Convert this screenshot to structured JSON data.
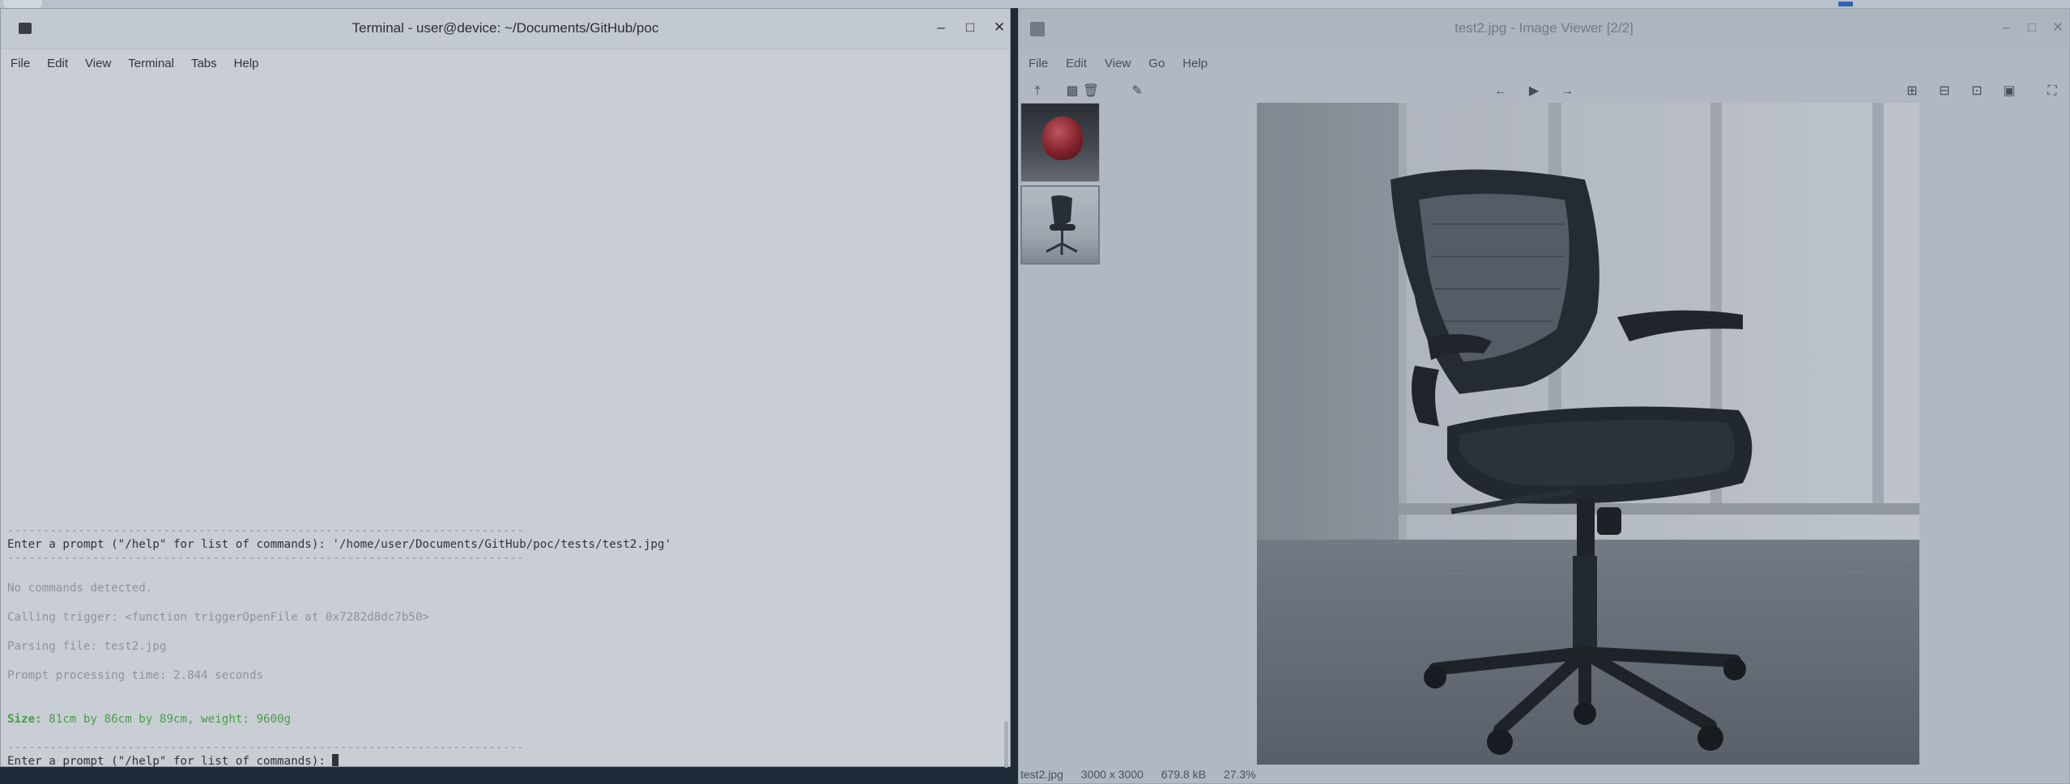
{
  "terminal": {
    "title": "Terminal - user@device: ~/Documents/GitHub/poc",
    "menu": [
      "File",
      "Edit",
      "View",
      "Terminal",
      "Tabs",
      "Help"
    ],
    "lines": {
      "sep1": "-------------------------------------------------------------------------",
      "prompt1": "Enter a prompt (\"/help\" for list of commands): '/home/user/Documents/GitHub/poc/tests/test2.jpg'",
      "sep2": "-------------------------------------------------------------------------",
      "no_commands": "No commands detected.",
      "calling": "Calling trigger: <function triggerOpenFile at 0x7282d8dc7b50>",
      "parsing": "Parsing file: test2.jpg",
      "timing": "Prompt processing time: 2.844 seconds",
      "size_label": "Size:",
      "size_value": " 81cm by 86cm by 89cm, weight: 9600g",
      "sep3": "-------------------------------------------------------------------------",
      "prompt2": "Enter a prompt (\"/help\" for list of commands): "
    }
  },
  "viewer": {
    "title": "test2.jpg - Image Viewer [2/2]",
    "menu": [
      "File",
      "Edit",
      "View",
      "Go",
      "Help"
    ],
    "status": {
      "filename": "test2.jpg",
      "dimensions": "3000 x 3000",
      "filesize": "679.8 kB",
      "zoom": "27.3%"
    }
  },
  "icons": {
    "min": "minimize-icon",
    "max": "maximize-icon",
    "close": "close-icon"
  }
}
